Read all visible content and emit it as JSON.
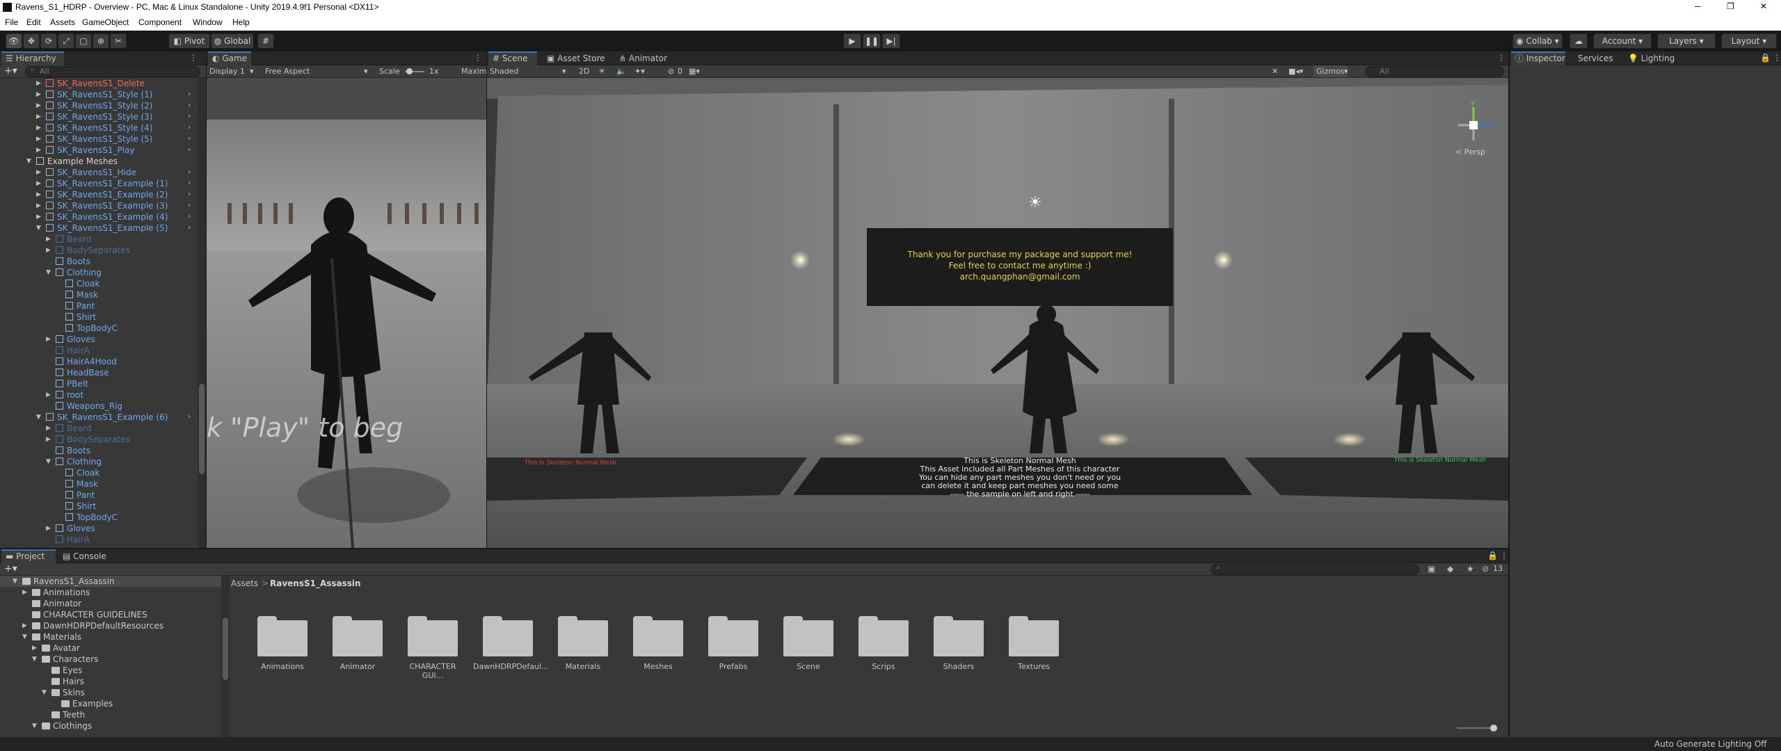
{
  "window": {
    "title": "Ravens_S1_HDRP - Overview - PC, Mac & Linux Standalone - Unity 2019.4.9f1 Personal <DX11>",
    "min": "─",
    "max": "❐",
    "close": "✕"
  },
  "menu": [
    "File",
    "Edit",
    "Assets",
    "GameObject",
    "Component",
    "Window",
    "Help"
  ],
  "toolbar": {
    "pivot": "Pivot",
    "global": "Global",
    "collab": "Collab",
    "account": "Account",
    "layers": "Layers",
    "layout": "Layout"
  },
  "hierarchy": {
    "tab": "Hierarchy",
    "search_placeholder": "All",
    "rows": [
      {
        "text": "SK_RavensS1_Delete",
        "indent": 1,
        "color": "red",
        "arrow": "▶",
        "more": false
      },
      {
        "text": "SK_RavensS1_Style (1)",
        "indent": 1,
        "color": "blue",
        "arrow": "▶",
        "more": true
      },
      {
        "text": "SK_RavensS1_Style (2)",
        "indent": 1,
        "color": "blue",
        "arrow": "▶",
        "more": true
      },
      {
        "text": "SK_RavensS1_Style (3)",
        "indent": 1,
        "color": "blue",
        "arrow": "▶",
        "more": true
      },
      {
        "text": "SK_RavensS1_Style (4)",
        "indent": 1,
        "color": "blue",
        "arrow": "▶",
        "more": true
      },
      {
        "text": "SK_RavensS1_Style (5)",
        "indent": 1,
        "color": "blue",
        "arrow": "▶",
        "more": true
      },
      {
        "text": "SK_RavensS1_Play",
        "indent": 1,
        "color": "blue",
        "arrow": "▶",
        "more": true
      },
      {
        "text": "Example Meshes",
        "indent": 0,
        "color": "white",
        "arrow": "▼",
        "more": false
      },
      {
        "text": "SK_RavensS1_Hide",
        "indent": 1,
        "color": "blue",
        "arrow": "▶",
        "more": true
      },
      {
        "text": "SK_RavensS1_Example (1)",
        "indent": 1,
        "color": "blue",
        "arrow": "▶",
        "more": true
      },
      {
        "text": "SK_RavensS1_Example (2)",
        "indent": 1,
        "color": "blue",
        "arrow": "▶",
        "more": true
      },
      {
        "text": "SK_RavensS1_Example (3)",
        "indent": 1,
        "color": "blue",
        "arrow": "▶",
        "more": true
      },
      {
        "text": "SK_RavensS1_Example (4)",
        "indent": 1,
        "color": "blue",
        "arrow": "▶",
        "more": true
      },
      {
        "text": "SK_RavensS1_Example (5)",
        "indent": 1,
        "color": "blue",
        "arrow": "▼",
        "more": true
      },
      {
        "text": "Beard",
        "indent": 2,
        "color": "blue-dim",
        "arrow": "▶",
        "more": false
      },
      {
        "text": "BodySeparates",
        "indent": 2,
        "color": "blue-dim",
        "arrow": "▶",
        "more": false
      },
      {
        "text": "Boots",
        "indent": 2,
        "color": "blue",
        "arrow": "",
        "more": false
      },
      {
        "text": "Clothing",
        "indent": 2,
        "color": "blue",
        "arrow": "▼",
        "more": false
      },
      {
        "text": "Cloak",
        "indent": 3,
        "color": "blue",
        "arrow": "",
        "more": false
      },
      {
        "text": "Mask",
        "indent": 3,
        "color": "blue",
        "arrow": "",
        "more": false
      },
      {
        "text": "Pant",
        "indent": 3,
        "color": "blue",
        "arrow": "",
        "more": false
      },
      {
        "text": "Shirt",
        "indent": 3,
        "color": "blue",
        "arrow": "",
        "more": false
      },
      {
        "text": "TopBodyC",
        "indent": 3,
        "color": "blue",
        "arrow": "",
        "more": false
      },
      {
        "text": "Gloves",
        "indent": 2,
        "color": "blue",
        "arrow": "▶",
        "more": false
      },
      {
        "text": "HairA",
        "indent": 2,
        "color": "blue-dim",
        "arrow": "",
        "more": false
      },
      {
        "text": "HairA4Hood",
        "indent": 2,
        "color": "blue",
        "arrow": "",
        "more": false
      },
      {
        "text": "HeadBase",
        "indent": 2,
        "color": "blue",
        "arrow": "",
        "more": false
      },
      {
        "text": "PBelt",
        "indent": 2,
        "color": "blue",
        "arrow": "",
        "more": false
      },
      {
        "text": "root",
        "indent": 2,
        "color": "blue",
        "arrow": "▶",
        "more": false
      },
      {
        "text": "Weapons_Rig",
        "indent": 2,
        "color": "blue",
        "arrow": "",
        "more": false
      },
      {
        "text": "SK_RavensS1_Example (6)",
        "indent": 1,
        "color": "blue",
        "arrow": "▼",
        "more": true
      },
      {
        "text": "Beard",
        "indent": 2,
        "color": "blue-dim",
        "arrow": "▶",
        "more": false
      },
      {
        "text": "BodySeparates",
        "indent": 2,
        "color": "blue-dim",
        "arrow": "▶",
        "more": false
      },
      {
        "text": "Boots",
        "indent": 2,
        "color": "blue",
        "arrow": "",
        "more": false
      },
      {
        "text": "Clothing",
        "indent": 2,
        "color": "blue",
        "arrow": "▼",
        "more": false
      },
      {
        "text": "Cloak",
        "indent": 3,
        "color": "blue",
        "arrow": "",
        "more": false
      },
      {
        "text": "Mask",
        "indent": 3,
        "color": "blue",
        "arrow": "",
        "more": false
      },
      {
        "text": "Pant",
        "indent": 3,
        "color": "blue",
        "arrow": "",
        "more": false
      },
      {
        "text": "Shirt",
        "indent": 3,
        "color": "blue",
        "arrow": "",
        "more": false
      },
      {
        "text": "TopBodyC",
        "indent": 3,
        "color": "blue",
        "arrow": "",
        "more": false
      },
      {
        "text": "Gloves",
        "indent": 2,
        "color": "blue",
        "arrow": "▶",
        "more": false
      },
      {
        "text": "HairA",
        "indent": 2,
        "color": "blue-dim",
        "arrow": "",
        "more": false
      }
    ]
  },
  "game": {
    "tab": "Game",
    "display": "Display 1",
    "aspect": "Free Aspect",
    "scale_label": "Scale",
    "scale_value": "1x",
    "maximize": "Maxim",
    "overlay_text": "k \"Play\" to beg"
  },
  "scene": {
    "tabs": [
      "Scene",
      "Asset Store",
      "Animator"
    ],
    "shading": "Shaded",
    "mode2d": "2D",
    "fx_count": "0",
    "gizmos": "Gizmos",
    "search_placeholder": "All",
    "persp": "< Persp",
    "gizmo_axes": {
      "y": "y",
      "z": "z"
    },
    "sign_lines": [
      "Thank you for purchase my package and support me!",
      "Feel free to contact me anytime :)",
      "arch.quangphan@gmail.com"
    ],
    "floor_lines": [
      "This is Skeleton Normal Mesh",
      "This Asset included all Part Meshes of this character",
      "You can hide any part meshes you don't need or you",
      "can delete it and keep part meshes you need some",
      "----- the sample on left and right -----"
    ],
    "colors": {
      "sign_text": "#e6d24a",
      "floor_red": "#e03b3b",
      "floor_green": "#3bc96a"
    }
  },
  "inspector": {
    "tabs": [
      "Inspector",
      "Services",
      "Lighting"
    ]
  },
  "project": {
    "tabs": [
      "Project",
      "Console"
    ],
    "tree": [
      {
        "text": "RavensS1_Assassin",
        "indent": 0,
        "arrow": "▼"
      },
      {
        "text": "Animations",
        "indent": 1,
        "arrow": "▶"
      },
      {
        "text": "Animator",
        "indent": 1,
        "arrow": ""
      },
      {
        "text": "CHARACTER GUIDELINES",
        "indent": 1,
        "arrow": ""
      },
      {
        "text": "DawnHDRPDefaultResources",
        "indent": 1,
        "arrow": "▶"
      },
      {
        "text": "Materials",
        "indent": 1,
        "arrow": "▼"
      },
      {
        "text": "Avatar",
        "indent": 2,
        "arrow": "▶"
      },
      {
        "text": "Characters",
        "indent": 2,
        "arrow": "▼"
      },
      {
        "text": "Eyes",
        "indent": 3,
        "arrow": ""
      },
      {
        "text": "Hairs",
        "indent": 3,
        "arrow": ""
      },
      {
        "text": "Skins",
        "indent": 3,
        "arrow": "▼"
      },
      {
        "text": "Examples",
        "indent": 4,
        "arrow": ""
      },
      {
        "text": "Teeth",
        "indent": 3,
        "arrow": ""
      },
      {
        "text": "Clothings",
        "indent": 2,
        "arrow": "▼"
      }
    ],
    "breadcrumb_root": "Assets",
    "breadcrumb_sep": ">",
    "breadcrumb_current": "RavensS1_Assassin",
    "items": [
      "Animations",
      "Animator",
      "CHARACTER GUI...",
      "DawnHDRPDefaul...",
      "Materials",
      "Meshes",
      "Prefabs",
      "Scene",
      "Scrips",
      "Shaders",
      "Textures"
    ],
    "count_badge": "13"
  },
  "statusbar": {
    "text": "Auto Generate Lighting Off"
  }
}
